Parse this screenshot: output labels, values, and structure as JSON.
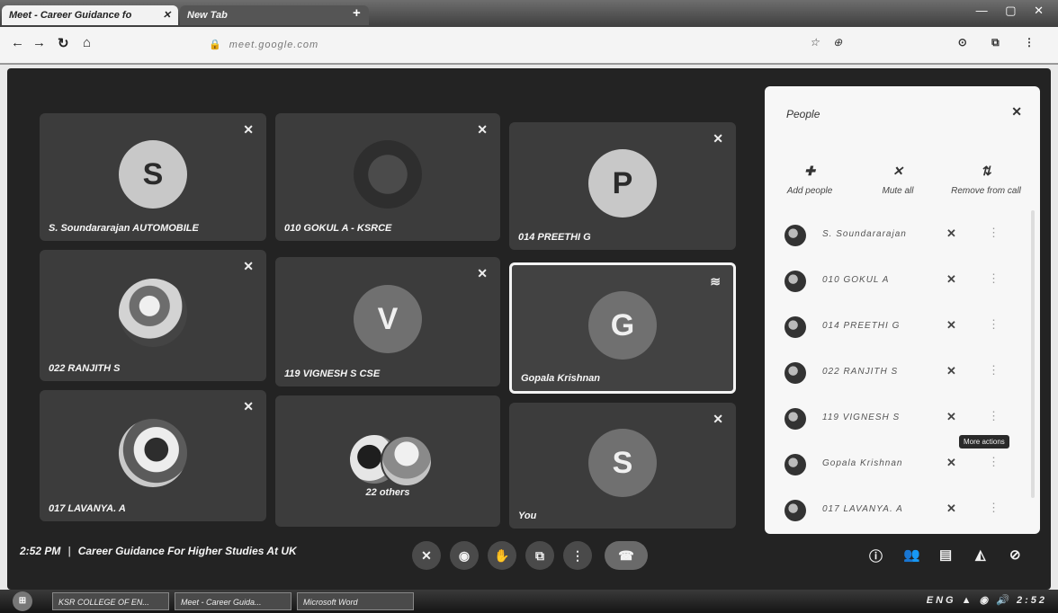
{
  "browser": {
    "tabs": [
      {
        "label": "Meet - Career Guidance fo",
        "close": "✕"
      },
      {
        "label": "New Tab",
        "close": "✕"
      }
    ],
    "new_tab": "+",
    "nav": {
      "back": "←",
      "forward": "→",
      "reload": "↻",
      "home": "⌂"
    },
    "url_prefix": "🔒",
    "url": "meet.google.com",
    "window_controls": "— ▢ ✕"
  },
  "tiles": [
    {
      "name": "S. Soundararajan AUTOMOBILE",
      "initial": "S",
      "mic": "✕"
    },
    {
      "name": "010 GOKUL A - KSRCE",
      "initial": "",
      "mic": "✕"
    },
    {
      "name": "014 PREETHI G",
      "initial": "P",
      "mic": "✕"
    },
    {
      "name": "022 RANJITH S",
      "initial": "",
      "mic": "✕"
    },
    {
      "name": "119 VIGNESH S CSE",
      "initial": "V",
      "mic": "✕"
    },
    {
      "name": "Gopala Krishnan",
      "initial": "G",
      "mic": "≋"
    },
    {
      "name": "017 LAVANYA. A",
      "initial": "",
      "mic": "✕"
    },
    {
      "name": "",
      "initial": "",
      "others_label": "22 others"
    },
    {
      "name": "You",
      "initial": "S",
      "mic": "✕"
    }
  ],
  "people_panel": {
    "title": "People",
    "close": "✕",
    "actions": [
      {
        "icon": "✚",
        "label": "Add people"
      },
      {
        "icon": "✕",
        "label": "Mute all"
      },
      {
        "icon": "⇅",
        "label": "Remove from call"
      }
    ],
    "participants": [
      {
        "name": "S. Soundararajan",
        "mic": "✕",
        "more": "⋮"
      },
      {
        "name": "010 GOKUL A",
        "mic": "✕",
        "more": "⋮"
      },
      {
        "name": "014 PREETHI G",
        "mic": "✕",
        "more": "⋮"
      },
      {
        "name": "022 RANJITH S",
        "mic": "✕",
        "more": "⋮"
      },
      {
        "name": "119 VIGNESH S",
        "mic": "✕",
        "more": "⋮"
      },
      {
        "name": "Gopala Krishnan",
        "mic": "✕",
        "more": "⋮"
      },
      {
        "name": "017 LAVANYA. A",
        "mic": "✕",
        "more": "⋮"
      }
    ],
    "tooltip": "More actions"
  },
  "meeting": {
    "time": "2:52 PM",
    "separator": "|",
    "title": "Career Guidance For Higher Studies At UK"
  },
  "controls": {
    "mic": "✕",
    "camera": "◉",
    "raise_hand": "✋",
    "present": "⧉",
    "more": "⋮",
    "end_call": "☎"
  },
  "right_controls": {
    "info": "ⓘ",
    "people": "👥",
    "chat": "▤",
    "activities": "◭",
    "lock": "⊘"
  },
  "taskbar": {
    "start": "⊞",
    "tasks": [
      "KSR COLLEGE OF EN...",
      "Meet - Career Guida...",
      "Microsoft Word"
    ],
    "tray": "ENG ▲ ◉ 🔊  2:52"
  }
}
